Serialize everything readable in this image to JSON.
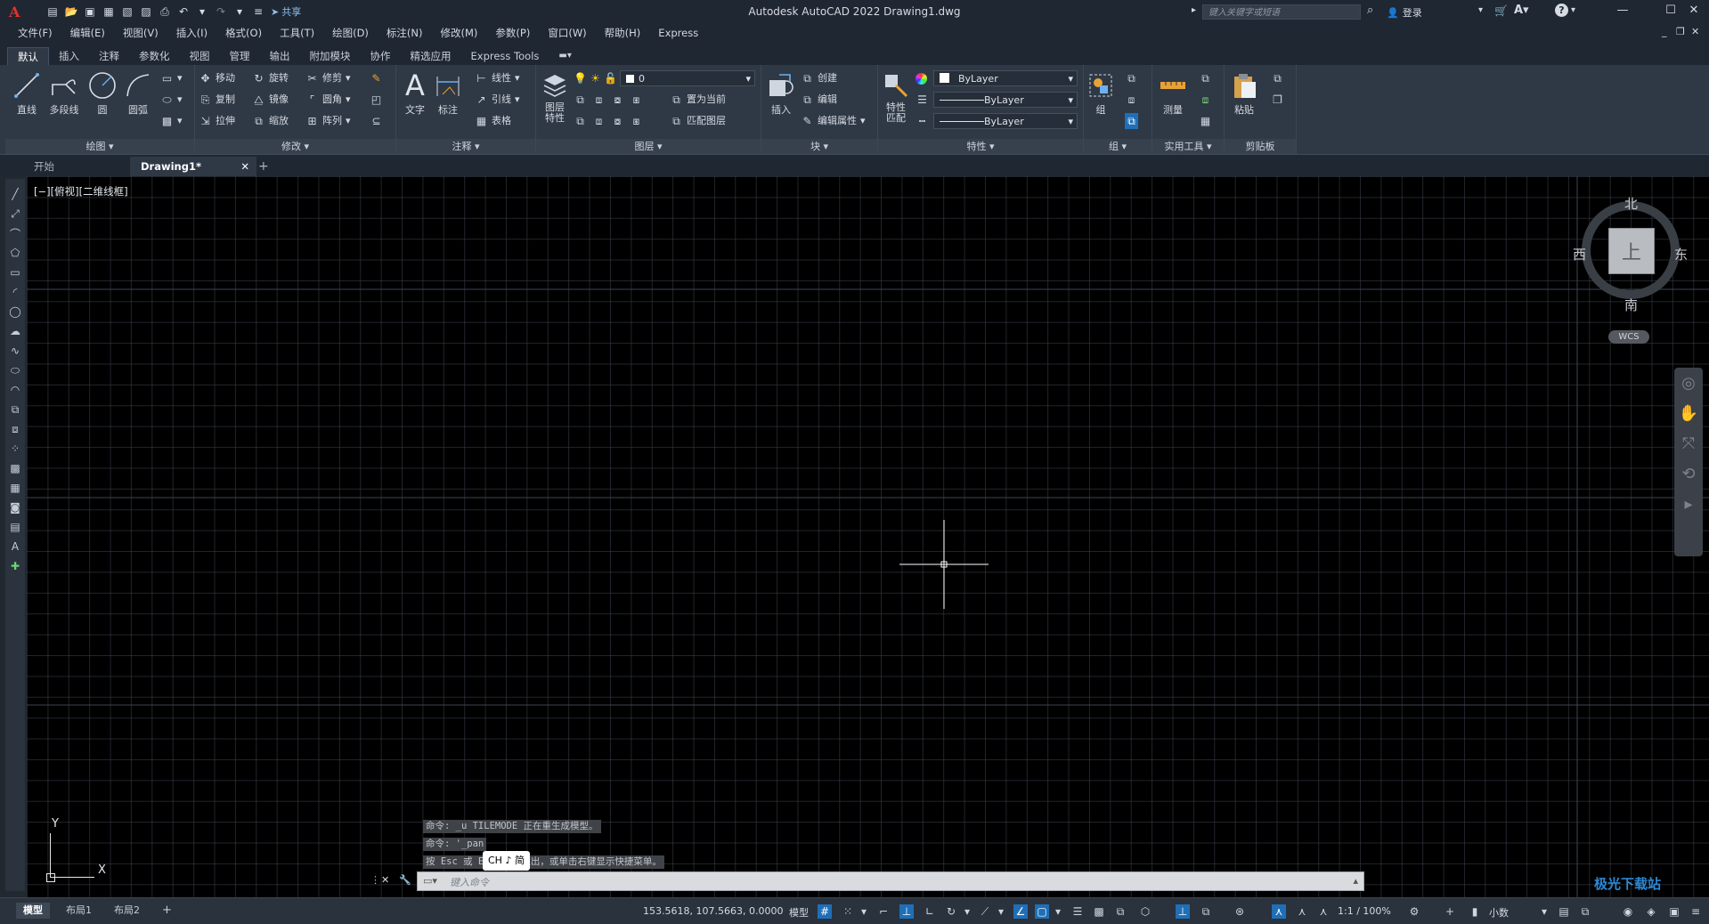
{
  "titlebar": {
    "app_logo": "A",
    "share_label": "共享",
    "title": "Autodesk AutoCAD 2022    Drawing1.dwg",
    "search_placeholder": "键入关键字或短语",
    "login_label": "登录"
  },
  "menubar": [
    "文件(F)",
    "编辑(E)",
    "视图(V)",
    "插入(I)",
    "格式(O)",
    "工具(T)",
    "绘图(D)",
    "标注(N)",
    "修改(M)",
    "参数(P)",
    "窗口(W)",
    "帮助(H)",
    "Express"
  ],
  "ribbon_tabs": [
    "默认",
    "插入",
    "注释",
    "参数化",
    "视图",
    "管理",
    "输出",
    "附加模块",
    "协作",
    "精选应用",
    "Express Tools"
  ],
  "ribbon": {
    "draw": {
      "title": "绘图",
      "line": "直线",
      "polyline": "多段线",
      "circle": "圆",
      "arc": "圆弧"
    },
    "modify": {
      "title": "修改",
      "move": "移动",
      "rotate": "旋转",
      "trim": "修剪",
      "copy": "复制",
      "mirror": "镜像",
      "fillet": "圆角",
      "stretch": "拉伸",
      "scale": "缩放",
      "array": "阵列"
    },
    "annotation": {
      "title": "注释",
      "text": "文字",
      "dimension": "标注",
      "linear": "线性",
      "leader": "引线",
      "table": "表格"
    },
    "layers": {
      "title": "图层",
      "layer_props": "图层\n特性",
      "layer_name": "0",
      "set_current": "置为当前",
      "match_layer": "匹配图层"
    },
    "block": {
      "title": "块",
      "insert": "插入",
      "create": "创建",
      "edit": "编辑",
      "edit_attr": "编辑属性"
    },
    "properties": {
      "title": "特性",
      "match": "特性\n匹配",
      "color": "ByLayer",
      "linetype": "ByLayer",
      "lineweight": "ByLayer"
    },
    "groups": {
      "title": "组",
      "group": "组"
    },
    "utilities": {
      "title": "实用工具",
      "measure": "测量"
    },
    "clipboard": {
      "title": "剪贴板",
      "paste": "粘贴"
    }
  },
  "doc_tabs": {
    "start": "开始",
    "drawing": "Drawing1*",
    "close": "✕",
    "add": "+"
  },
  "viewport_label": "[−][俯视][二维线框]",
  "viewcube": {
    "north": "北",
    "south": "南",
    "east": "东",
    "west": "西",
    "face": "上",
    "wcs": "WCS"
  },
  "ucs": {
    "y": "Y",
    "x": "X"
  },
  "command_history": [
    "命令: _u TILEMODE 正在重生成模型。",
    "命令: '_pan",
    "按 Esc 或 Enter 键退出，或单击右键显示快捷菜单。"
  ],
  "ime_label": "CH ♪ 简",
  "command_placeholder": "键入命令",
  "layout_tabs": [
    "模型",
    "布局1",
    "布局2"
  ],
  "statusbar": {
    "coords": "153.5618, 107.5663, 0.0000",
    "model": "模型",
    "scale": "1:1 / 100%",
    "units": "小数"
  },
  "watermark": "极光下载站",
  "colors": {
    "accent": "#1f6fb8",
    "canvas": "#000000",
    "ribbon": "#2f3845",
    "logo": "#e0322f"
  }
}
